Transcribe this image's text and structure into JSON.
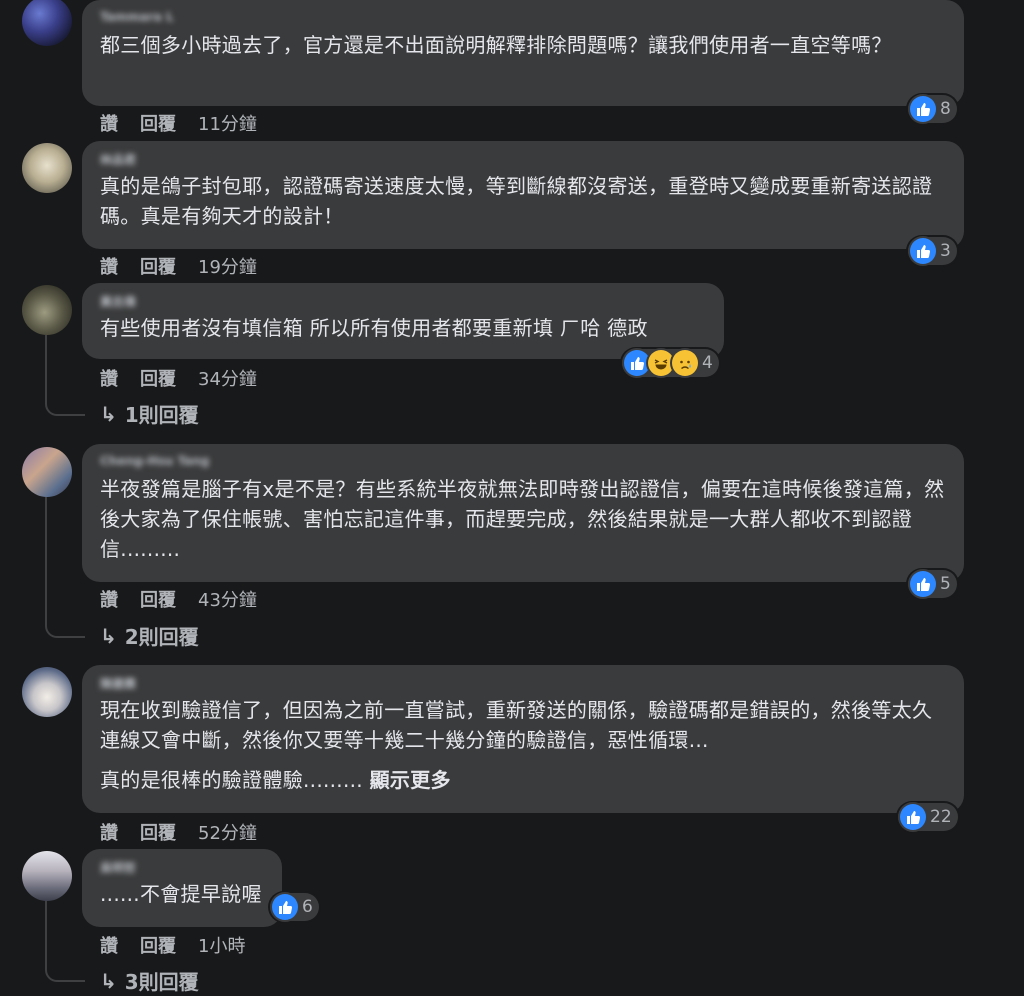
{
  "comments": [
    {
      "author": "Tammara L",
      "text": "都三個多小時過去了，官方還是不出面說明解釋排除問題嗎？讓我們使用者一直空等嗎？",
      "reaction_count": "8",
      "like": "讚",
      "reply": "回覆",
      "time": "11分鐘"
    },
    {
      "author": "林品君",
      "text": "真的是鴿子封包耶，認證碼寄送速度太慢，等到斷線都沒寄送，重登時又變成要重新寄送認證碼。真是有夠天才的設計！",
      "reaction_count": "3",
      "like": "讚",
      "reply": "回覆",
      "time": "19分鐘"
    },
    {
      "author": "黃志偉",
      "text": "有些使用者沒有填信箱 所以所有使用者都要重新填 ㄏ哈 德政",
      "reaction_count": "4",
      "like": "讚",
      "reply": "回覆",
      "time": "34分鐘",
      "replies": "1則回覆"
    },
    {
      "author": "Cheng-Hsu Tang",
      "text": "半夜發篇是腦子有x是不是？有些系統半夜就無法即時發出認證信，偏要在這時候後發這篇，然後大家為了保住帳號、害怕忘記這件事，而趕要完成，然後結果就是一大群人都收不到認證信.........",
      "reaction_count": "5",
      "like": "讚",
      "reply": "回覆",
      "time": "43分鐘",
      "replies": "2則回覆"
    },
    {
      "author": "陳建霖",
      "text": "現在收到驗證信了，但因為之前一直嘗試，重新發送的關係，驗證碼都是錯誤的，然後等太久連線又會中斷，然後你又要等十幾二十幾分鐘的驗證信，惡性循環...",
      "text2": "真的是很棒的驗證體驗.........",
      "see_more": "顯示更多",
      "reaction_count": "22",
      "like": "讚",
      "reply": "回覆",
      "time": "52分鐘"
    },
    {
      "author": "吳明哲",
      "text": "......不會提早說喔",
      "reaction_count": "6",
      "like": "讚",
      "reply": "回覆",
      "time": "1小時",
      "replies": "3則回覆"
    }
  ],
  "icons": {
    "like": "like-thumb-icon",
    "haha": "haha-emoji-icon",
    "sad": "sad-emoji-icon",
    "reply_arrow": "reply-arrow-icon"
  },
  "colors": {
    "background": "#18191a",
    "bubble": "#3a3b3c",
    "like_blue": "#2d88ff"
  }
}
